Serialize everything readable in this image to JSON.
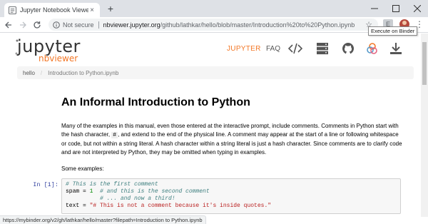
{
  "browser": {
    "tab_title": "Jupyter Notebook Viewer",
    "tab_close": "×",
    "new_tab": "+",
    "security_label": "Not secure",
    "url_host": "nbviewer.jupyter.org",
    "url_path": "/github/lathkar/hello/blob/master/Introduction%20to%20Python.ipynb",
    "bookmark_star": "☆",
    "extension_label": "E",
    "menu_dots": "⋮",
    "status_url": "https://mybinder.org/v2/gh/lathkar/hello/master?filepath=Introduction to Python.ipynb"
  },
  "header": {
    "logo_text": "jupyter",
    "logo_sub": "nbviewer",
    "nav_jupyter": "JUPYTER",
    "nav_faq": "FAQ",
    "tooltip": "Execute on Binder"
  },
  "breadcrumb": {
    "root": "hello",
    "separator": "/",
    "current": "Introduction to Python.ipynb"
  },
  "notebook": {
    "title": "An Informal Introduction to Python",
    "para1_a": "Many of the examples in this manual, even those entered at the interactive prompt, include comments. Comments in Python start with the hash character, ",
    "para1_code": "#",
    "para1_b": ", and extend to the end of the physical line. A comment may appear at the start of a line or following whitespace or code, but not within a string literal. A hash character within a string literal is just a hash character. Since comments are to clarify code and are not interpreted by Python, they may be omitted when typing in examples.",
    "para2": "Some examples:",
    "cell_prompt": "In [1]:",
    "code": {
      "l1_comment": "# This is the first comment",
      "l2_code": "spam = ",
      "l2_num": "1",
      "l2_comment": "  # and this is the second comment",
      "l3_comment": "          # ... and now a third!",
      "l4_code": "text = ",
      "l4_str": "\"# This is not a comment because it's inside quotes.\""
    }
  },
  "colors": {
    "accent": "#f37726",
    "prompt": "#303f9f"
  }
}
